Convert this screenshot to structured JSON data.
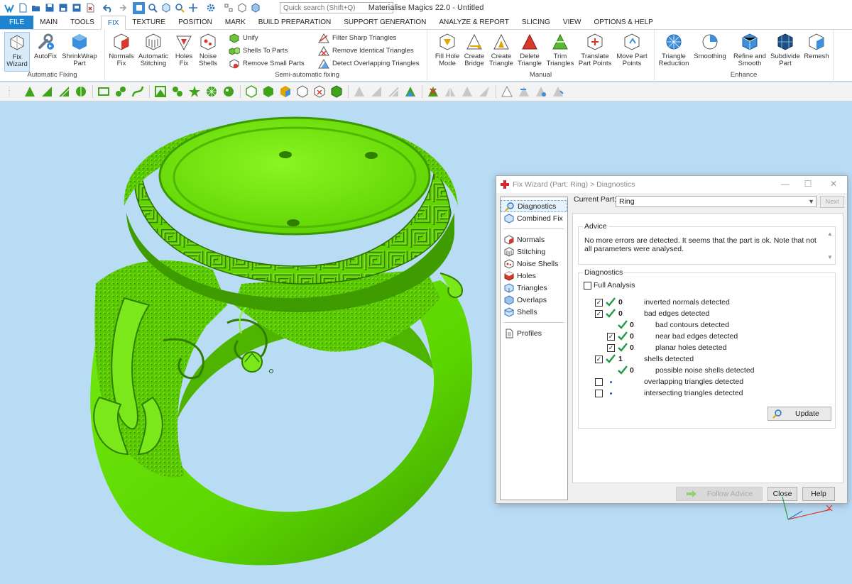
{
  "app": {
    "title": "Materialise Magics 22.0 - Untitled",
    "quick_search_placeholder": "Quick search (Shift+Q)"
  },
  "tabs": [
    "FILE",
    "MAIN",
    "TOOLS",
    "FIX",
    "TEXTURE",
    "POSITION",
    "MARK",
    "BUILD PREPARATION",
    "SUPPORT GENERATION",
    "ANALYZE & REPORT",
    "SLICING",
    "VIEW",
    "OPTIONS & HELP"
  ],
  "active_tab": "FIX",
  "ribbon": {
    "automatic_fixing": {
      "label": "Automatic Fixing",
      "buttons": [
        {
          "line1": "Fix",
          "line2": "Wizard"
        },
        {
          "line1": "AutoFix",
          "line2": ""
        },
        {
          "line1": "ShrinkWrap",
          "line2": "Part"
        }
      ]
    },
    "semi_automatic": {
      "label": "Semi-automatic fixing",
      "buttons": [
        {
          "line1": "Normals",
          "line2": "Fix"
        },
        {
          "line1": "Automatic",
          "line2": "Stitching"
        },
        {
          "line1": "Holes",
          "line2": "Fix"
        },
        {
          "line1": "Noise",
          "line2": "Shells"
        }
      ],
      "small": [
        "Unify",
        "Shells To Parts",
        "Remove Small Parts"
      ],
      "small2": [
        "Filter Sharp Triangles",
        "Remove Identical Triangles",
        "Detect Overlapping Triangles"
      ]
    },
    "manual": {
      "label": "Manual",
      "buttons": [
        {
          "line1": "Fill Hole",
          "line2": "Mode"
        },
        {
          "line1": "Create",
          "line2": "Bridge"
        },
        {
          "line1": "Create",
          "line2": "Triangle"
        },
        {
          "line1": "Delete",
          "line2": "Triangle"
        },
        {
          "line1": "Trim",
          "line2": "Triangles"
        },
        {
          "line1": "Translate",
          "line2": "Part Points"
        },
        {
          "line1": "Move Part",
          "line2": "Points"
        }
      ]
    },
    "enhance": {
      "label": "Enhance",
      "buttons": [
        {
          "line1": "Triangle",
          "line2": "Reduction"
        },
        {
          "line1": "Smoothing",
          "line2": ""
        },
        {
          "line1": "Refine and",
          "line2": "Smooth"
        },
        {
          "line1": "Subdivide",
          "line2": "Part"
        },
        {
          "line1": "Remesh",
          "line2": ""
        }
      ]
    }
  },
  "dialog": {
    "title": "Fix Wizard (Part: Ring) > Diagnostics",
    "nav_top": [
      "Diagnostics",
      "Combined Fix"
    ],
    "nav_mid": [
      "Normals",
      "Stitching",
      "Noise Shells",
      "Holes",
      "Triangles",
      "Overlaps",
      "Shells"
    ],
    "nav_bottom": [
      "Profiles"
    ],
    "current_part_label": "Current Part:",
    "current_part_value": "Ring",
    "next_label": "Next",
    "advice_legend": "Advice",
    "advice_text": "No more errors are detected. It seems that the part is ok. Note that not all parameters were analysed.",
    "diagnostics_legend": "Diagnostics",
    "full_analysis_label": "Full Analysis",
    "rows": [
      {
        "checkbox": true,
        "checked": true,
        "status": "ok",
        "count": "0",
        "label": "inverted normals detected"
      },
      {
        "checkbox": true,
        "checked": true,
        "status": "ok",
        "count": "0",
        "label": "bad edges detected"
      },
      {
        "checkbox": false,
        "checked": false,
        "status": "ok",
        "count": "0",
        "label": "bad contours detected"
      },
      {
        "checkbox": true,
        "checked": true,
        "status": "ok",
        "count": "0",
        "label": "near bad edges detected"
      },
      {
        "checkbox": true,
        "checked": true,
        "status": "ok",
        "count": "0",
        "label": "planar holes detected"
      },
      {
        "checkbox": true,
        "checked": true,
        "status": "ok",
        "count": "1",
        "label": "shells detected"
      },
      {
        "checkbox": false,
        "checked": false,
        "status": "ok",
        "count": "0",
        "label": "possible noise shells detected"
      },
      {
        "checkbox": true,
        "checked": false,
        "status": "none",
        "count": "",
        "label": "overlapping triangles detected"
      },
      {
        "checkbox": true,
        "checked": false,
        "status": "none",
        "count": "",
        "label": "intersecting triangles detected"
      }
    ],
    "update_label": "Update",
    "follow_advice_label": "Follow Advice",
    "close_label": "Close",
    "help_label": "Help"
  },
  "colors": {
    "ring": "#66e400",
    "viewport": "#b9dcf5",
    "accent": "#1e84d0",
    "check": "#1f9a3c"
  }
}
